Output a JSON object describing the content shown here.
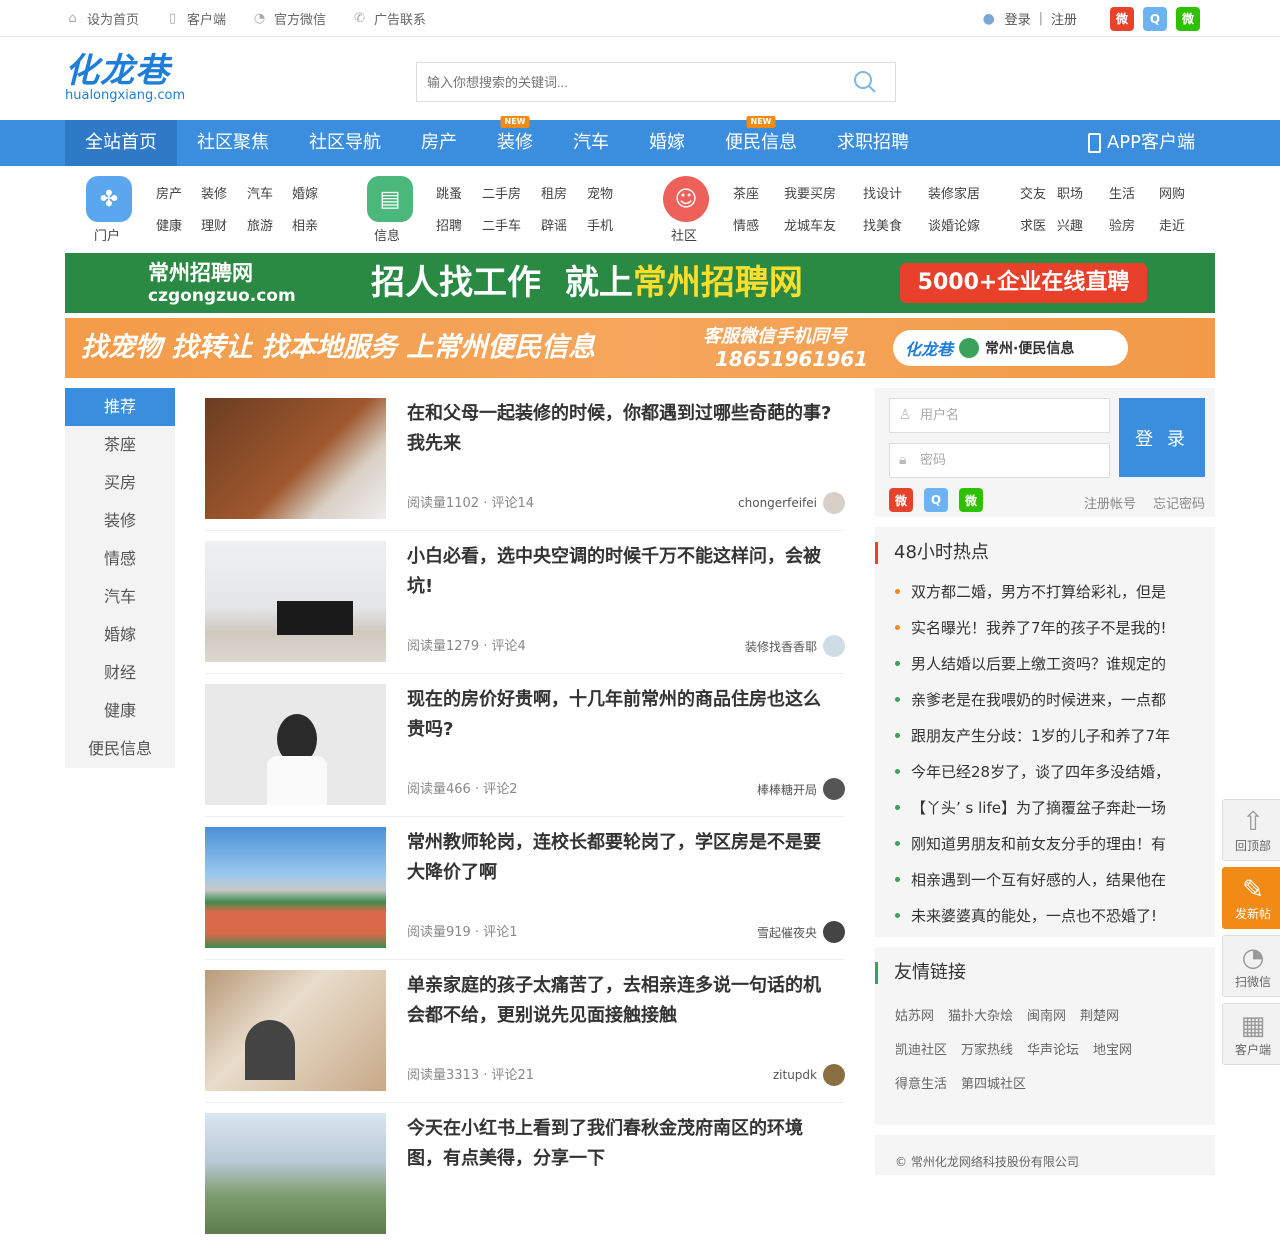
{
  "topbar": {
    "links": [
      {
        "label": "设为首页",
        "icon": "home-icon"
      },
      {
        "label": "客户端",
        "icon": "mobile-icon"
      },
      {
        "label": "官方微信",
        "icon": "wechat-icon"
      },
      {
        "label": "广告联系",
        "icon": "phone-icon"
      }
    ],
    "login": "登录",
    "separator": "|",
    "register": "注册"
  },
  "header": {
    "logo_cn": "化龙巷",
    "logo_en": "hualongxiang.com",
    "search_placeholder": "输入你想搜索的关键词..."
  },
  "nav": {
    "items": [
      {
        "label": "全站首页",
        "active": true
      },
      {
        "label": "社区聚焦"
      },
      {
        "label": "社区导航"
      },
      {
        "label": "房产"
      },
      {
        "label": "装修",
        "badge": "NEW"
      },
      {
        "label": "汽车"
      },
      {
        "label": "婚嫁"
      },
      {
        "label": "便民信息",
        "badge": "NEW"
      },
      {
        "label": "求职招聘"
      }
    ],
    "app": "APP客户端"
  },
  "categories": {
    "portal": {
      "label": "门户",
      "rows": [
        [
          "房产",
          "装修",
          "汽车",
          "婚嫁"
        ],
        [
          "健康",
          "理财",
          "旅游",
          "相亲"
        ]
      ]
    },
    "info": {
      "label": "信息",
      "rows": [
        [
          "跳蚤",
          "二手房",
          "租房",
          "宠物"
        ],
        [
          "招聘",
          "二手车",
          "辟谣",
          "手机"
        ]
      ]
    },
    "community": {
      "label": "社区",
      "rows": [
        [
          "茶座",
          "我要买房",
          "找设计",
          "装修家居",
          "交友",
          "职场",
          "生活",
          "网购"
        ],
        [
          "情感",
          "龙城车友",
          "找美食",
          "谈婚论嫁",
          "求医",
          "兴趣",
          "验房",
          "走近"
        ]
      ]
    }
  },
  "banners": {
    "b1": {
      "brand": "常州招聘网",
      "domain": "czgongzuo.com",
      "slogan1": "招人找工作",
      "slogan2": "就上",
      "slogan3": "常州招聘网",
      "badge": "5000+企业在线直聘"
    },
    "b2": {
      "text": "找宠物 找转让 找本地服务 上常州便民信息",
      "contact_label": "客服微信手机同号",
      "phone": "18651961961",
      "tag": "常州·便民信息"
    }
  },
  "leftnav": [
    "推荐",
    "茶座",
    "买房",
    "装修",
    "情感",
    "汽车",
    "婚嫁",
    "财经",
    "健康",
    "便民信息"
  ],
  "articles": [
    {
      "title": "在和父母一起装修的时候，你都遇到过哪些奇葩的事?我先来",
      "meta": "阅读量1102 · 评论14",
      "author": "chongerfeifei"
    },
    {
      "title": "小白必看，选中央空调的时候千万不能这样问，会被坑!",
      "meta": "阅读量1279 · 评论4",
      "author": "装修找香香耶"
    },
    {
      "title": "现在的房价好贵啊，十几年前常州的商品住房也这么贵吗?",
      "meta": "阅读量466 · 评论2",
      "author": "棒棒糖开局"
    },
    {
      "title": "常州教师轮岗，连校长都要轮岗了，学区房是不是要大降价了啊",
      "meta": "阅读量919 · 评论1",
      "author": "雪起催夜央"
    },
    {
      "title": "单亲家庭的孩子太痛苦了，去相亲连多说一句话的机会都不给，更别说先见面接触接触",
      "meta": "阅读量3313 · 评论21",
      "author": "zitupdk"
    },
    {
      "title": "今天在小红书上看到了我们春秋金茂府南区的环境图，有点美得，分享一下",
      "meta": "",
      "author": ""
    }
  ],
  "login": {
    "username_placeholder": "用户名",
    "password_placeholder": "密码",
    "button": "登 录",
    "register": "注册帐号",
    "forgot": "忘记密码"
  },
  "hot": {
    "title": "48小时热点",
    "items": [
      "双方都二婚，男方不打算给彩礼，但是",
      "实名曝光！我养了7年的孩子不是我的!",
      "男人结婚以后要上缴工资吗？谁规定的",
      "亲爹老是在我喂奶的时候进来，一点都",
      "跟朋友产生分歧：1岁的儿子和养了7年",
      "今年已经28岁了，谈了四年多没结婚，",
      "【丫头’ s life】为了摘覆盆子奔赴一场",
      "刚知道男朋友和前女友分手的理由！有",
      "相亲遇到一个互有好感的人，结果他在",
      "未来婆婆真的能处，一点也不恐婚了!"
    ],
    "dot_colors": [
      "#f28a16",
      "#f28a16",
      "#3aa35b",
      "#3aa35b",
      "#3aa35b",
      "#3aa35b",
      "#3aa35b",
      "#3aa35b",
      "#3aa35b",
      "#3aa35b"
    ]
  },
  "friends": {
    "title": "友情链接",
    "rows": [
      [
        "姑苏网",
        "猫扑大杂烩",
        "闽南网",
        "荆楚网"
      ],
      [
        "凯迪社区",
        "万家热线",
        "华声论坛",
        "地宝网"
      ],
      [
        "得意生活",
        "第四城社区"
      ]
    ]
  },
  "footer": {
    "text": "© 常州化龙网络科技股份有限公司"
  },
  "floatbar": [
    {
      "label": "回顶部",
      "icon": "arrow-up-icon"
    },
    {
      "label": "发新帖",
      "icon": "pencil-icon"
    },
    {
      "label": "扫微信",
      "icon": "wechat-icon"
    },
    {
      "label": "客户端",
      "icon": "qrcode-icon"
    }
  ],
  "colors": {
    "primary": "#3b8ddd",
    "nav_active": "#2e7ac7",
    "orange": "#f28a16",
    "green": "#3aa35b",
    "weibo": "#e6432c",
    "qq": "#6db3f2",
    "wechat": "#2dc100"
  }
}
